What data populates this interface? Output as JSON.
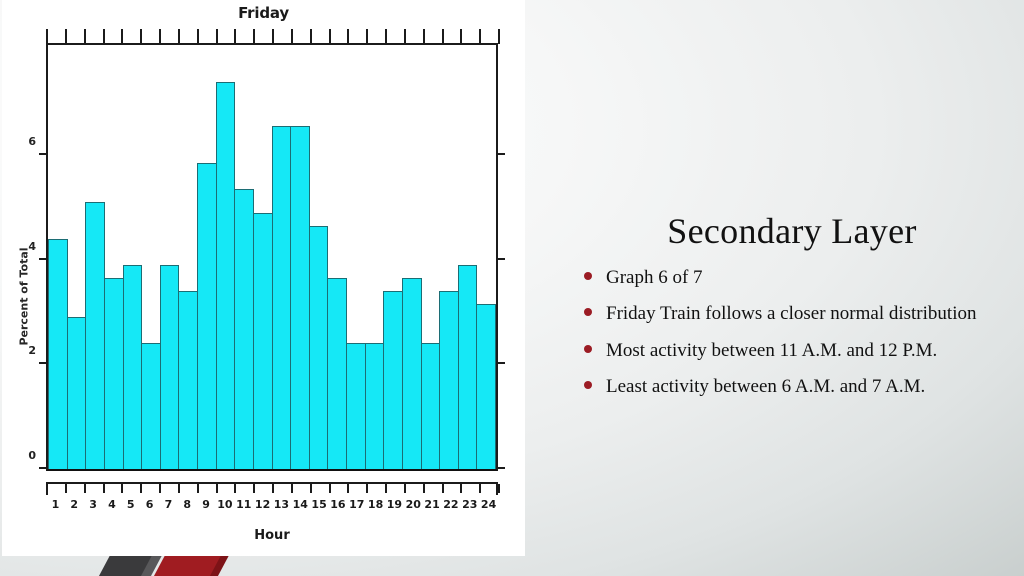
{
  "slide": {
    "title": "Secondary Layer",
    "bullets": [
      "Graph 6 of 7",
      "Friday Train follows a closer normal distribution",
      "Most activity between 11 A.M. and 12 P.M.",
      "Least activity between 6 A.M. and 7 A.M."
    ],
    "accent_color": "#9b1c24",
    "deco_dark_color": "#3a3a3c",
    "deco_red_color": "#a01c21"
  },
  "chart_data": {
    "type": "bar",
    "title": "Friday",
    "xlabel": "Hour",
    "ylabel": "Percent of Total",
    "categories": [
      "1",
      "2",
      "3",
      "4",
      "5",
      "6",
      "7",
      "8",
      "9",
      "10",
      "11",
      "12",
      "13",
      "14",
      "15",
      "16",
      "17",
      "18",
      "19",
      "20",
      "21",
      "22",
      "23",
      "24"
    ],
    "values": [
      4.4,
      2.9,
      5.1,
      3.65,
      3.9,
      2.4,
      3.9,
      3.4,
      5.85,
      7.4,
      5.35,
      4.9,
      6.55,
      6.55,
      4.65,
      3.65,
      2.4,
      2.4,
      3.4,
      3.65,
      2.4,
      3.4,
      3.9,
      3.15
    ],
    "ylim": [
      0,
      8.1
    ],
    "yticks": [
      0,
      2,
      4,
      6
    ],
    "ytick_labels": [
      "0",
      "2",
      "4",
      "6"
    ],
    "grid": false,
    "legend": "none",
    "bar_fill_color": "#15e8f6",
    "bar_edge_color": "#1c6d74"
  }
}
